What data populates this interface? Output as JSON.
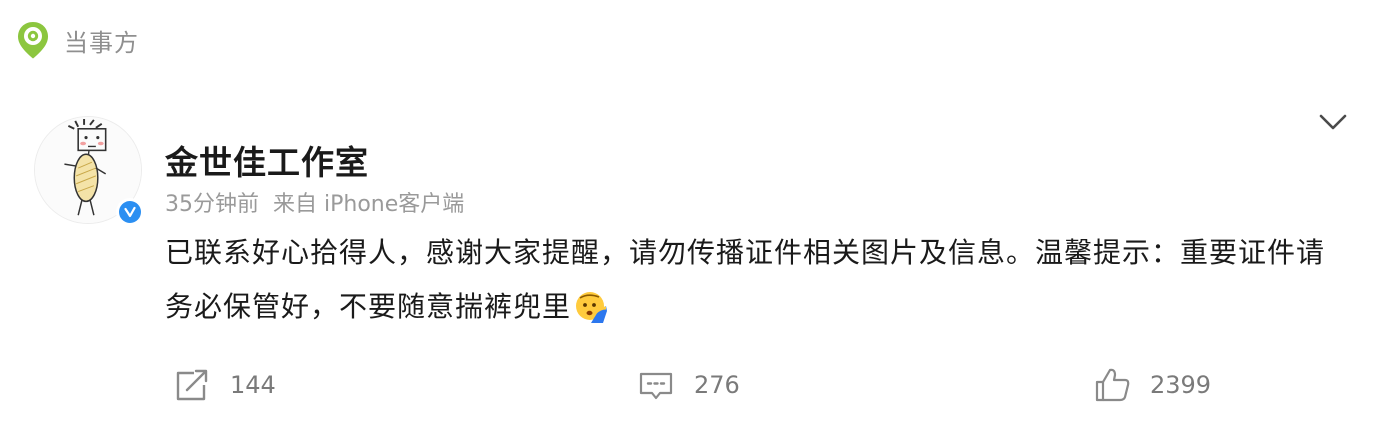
{
  "section": {
    "title": "当事方",
    "icon": "location-pin-icon",
    "accent_color": "#8cc63f"
  },
  "post": {
    "author": {
      "name": "金世佳工作室",
      "verified": true,
      "verified_color": "#2b8ff2"
    },
    "time": "35分钟前",
    "source": "来自 iPhone客户端",
    "text": "已联系好心拾得人，感谢大家提醒，请勿传播证件相关图片及信息。温馨提示：重要证件请务必保管好，不要随意揣裤兜里",
    "emoji": "saluting-face-emoji",
    "more_icon": "chevron-down-icon"
  },
  "actions": {
    "repost": {
      "icon": "repost-icon",
      "count": "144"
    },
    "comment": {
      "icon": "comment-icon",
      "count": "276"
    },
    "like": {
      "icon": "thumbs-up-icon",
      "count": "2399"
    }
  }
}
